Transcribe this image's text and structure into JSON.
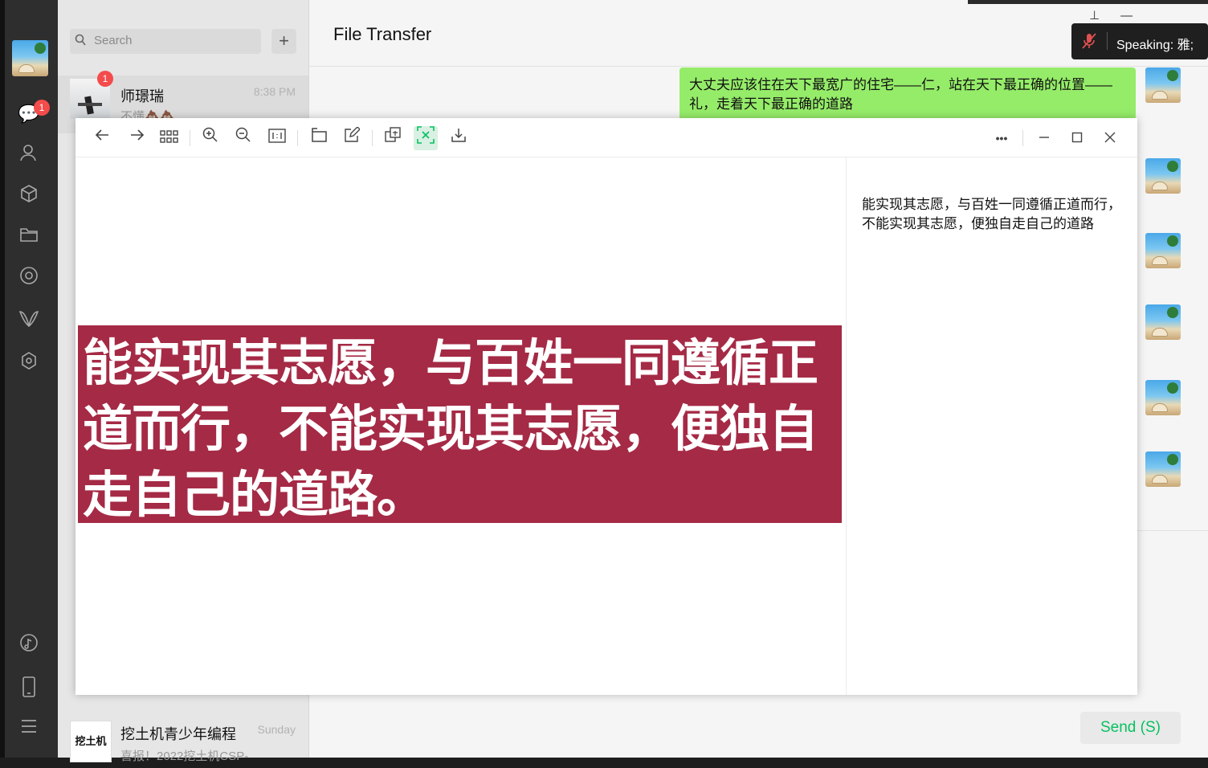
{
  "rail": {
    "chat_badge": "1",
    "icons": [
      "chats-icon",
      "contacts-icon",
      "favorites-icon",
      "files-icon",
      "moments-icon",
      "channels-icon",
      "mini-programs-icon",
      "music-icon",
      "phone-icon",
      "menu-icon"
    ]
  },
  "search": {
    "placeholder": "Search"
  },
  "chats": [
    {
      "name": "师璟瑞",
      "time": "8:38 PM",
      "preview": "不懂💩💩",
      "badge": "1"
    },
    {
      "name": "挖土机青少年编程",
      "time": "Sunday",
      "preview": "喜报！2022挖土机CSP-"
    }
  ],
  "chat_avatar_text": "挖土机",
  "main": {
    "title": "File Transfer",
    "message": "大丈夫应该住在天下最宽广的住宅——仁，站在天下最正确的位置——礼，走着天下最正确的道路",
    "send_label": "Send (S)"
  },
  "speaking": {
    "label": "Speaking: 雅;"
  },
  "viewer": {
    "tools": [
      "back-icon",
      "forward-icon",
      "grid-icon",
      "zoom-in-icon",
      "zoom-out-icon",
      "actual-size-icon",
      "rotate-icon",
      "edit-icon",
      "translate-icon",
      "extract-text-icon",
      "download-icon"
    ],
    "more_label": "•••",
    "image_text": "能实现其志愿，与百姓一同遵循正道而行，不能实现其志愿，便独自走自己的道路。",
    "ocr_text": "能实现其志愿，与百姓一同遵循正道而行，不能实现其志愿，便独自走自己的道路"
  },
  "colors": {
    "accent": "#07c160",
    "bubble": "#95ec69",
    "image_bg": "#a52a45"
  }
}
